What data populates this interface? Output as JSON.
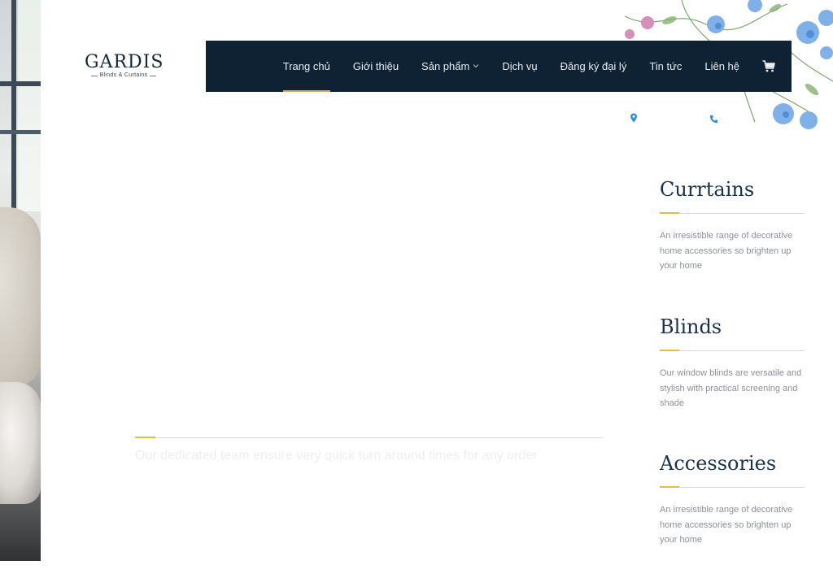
{
  "logo": {
    "brand": "GARDIS",
    "tagline": "Blinds & Curtains"
  },
  "nav": {
    "items": [
      {
        "label": "Trang chủ",
        "active": true
      },
      {
        "label": "Giới thiệu",
        "active": false
      },
      {
        "label": "Sản phẩm",
        "active": false,
        "has_dropdown": true
      },
      {
        "label": "Dịch vụ",
        "active": false
      },
      {
        "label": "Đăng ký đại lý",
        "active": false
      },
      {
        "label": "Tin tức",
        "active": false
      },
      {
        "label": "Liên hệ",
        "active": false
      }
    ],
    "cart_icon": "shopping-cart-icon"
  },
  "contact": {
    "location_icon": "map-pin-icon",
    "phone_icon": "phone-icon"
  },
  "services": [
    {
      "title": "Currtains",
      "description": "An irresistible range of decorative home accessories so brighten up your home"
    },
    {
      "title": "Blinds",
      "description": "Our window blinds are versatile and stylish with practical screening and shade"
    },
    {
      "title": "Accessories",
      "description": "An irresistible range of decorative home accessories so brighten up your home"
    }
  ],
  "hero": {
    "tagline": "Our dedicated team ensure very quick turn around times for any order"
  },
  "colors": {
    "nav_background": "#0f2233",
    "accent": "#e8b93a",
    "heading": "#1a3148",
    "body_text": "#8b9198",
    "icon_blue": "#2e8fd6"
  }
}
